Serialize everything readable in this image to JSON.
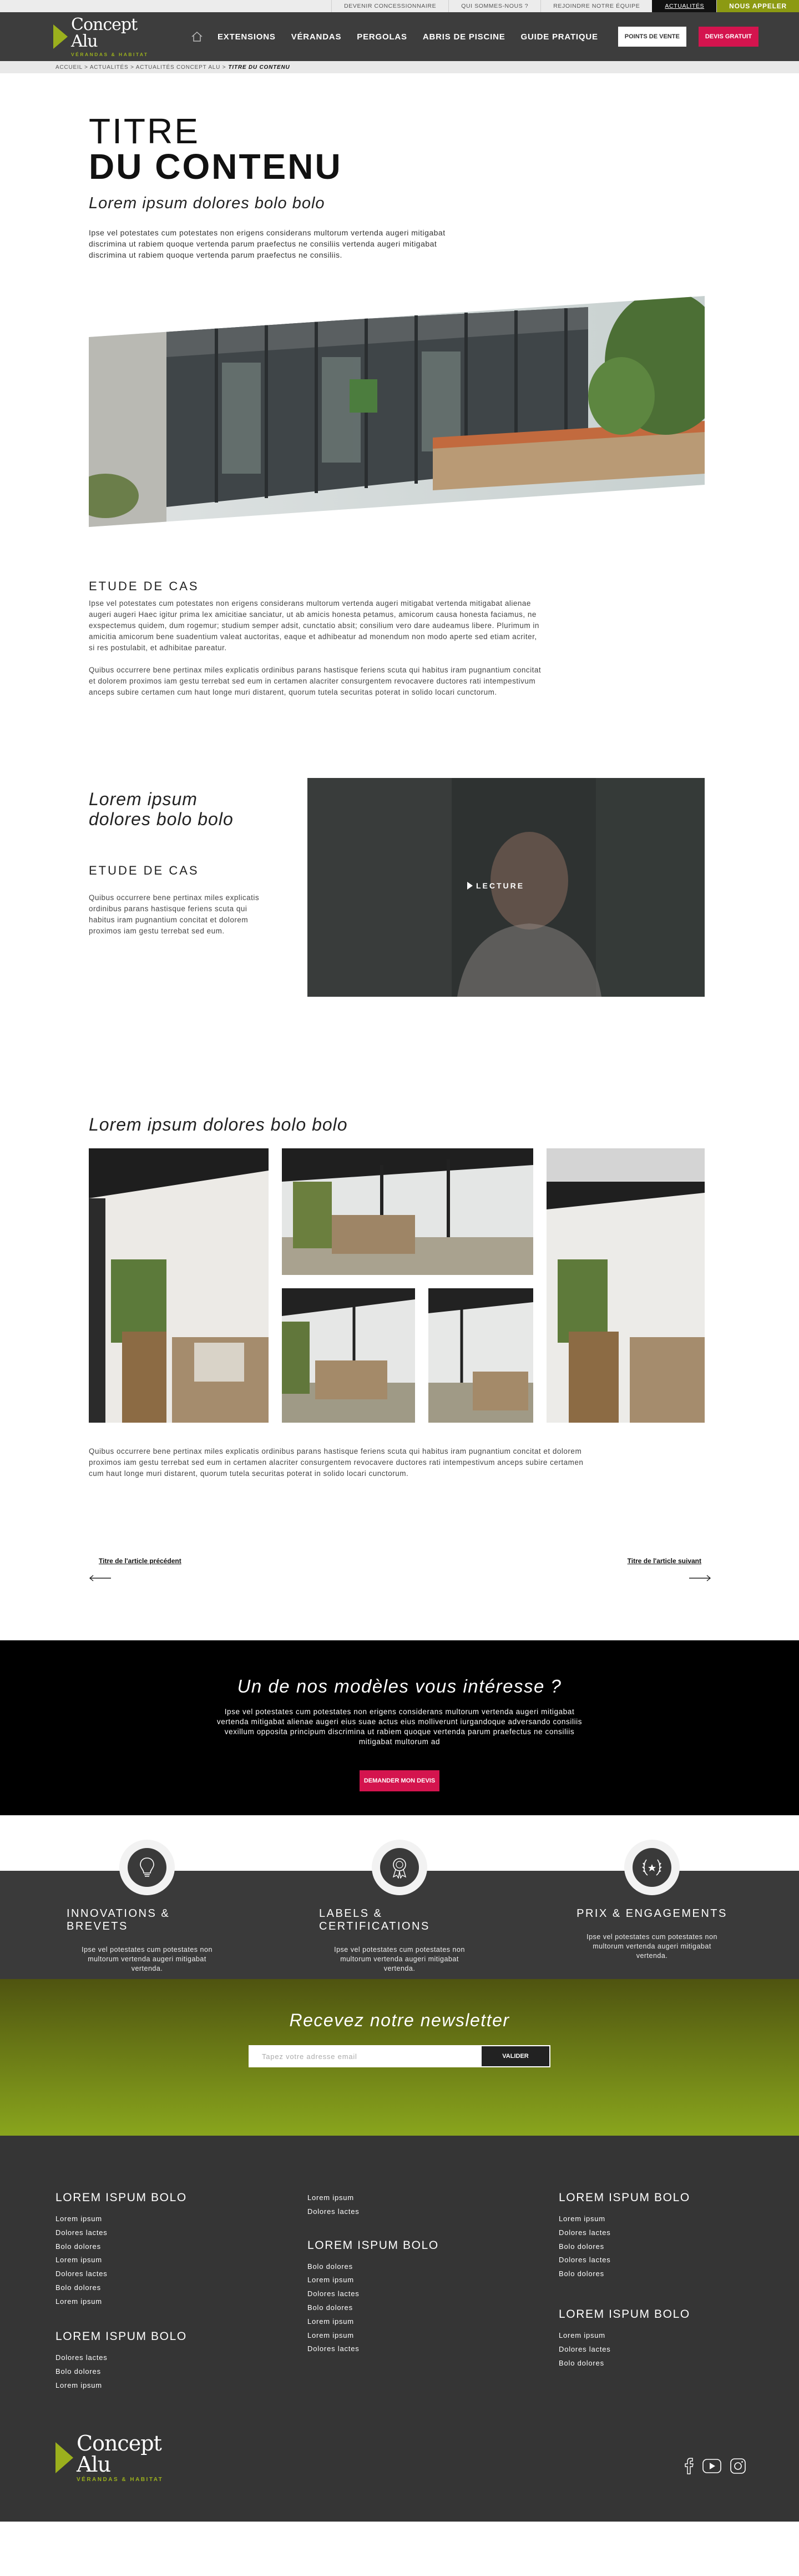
{
  "topbar": {
    "items": [
      "DEVENIR CONCESSIONNAIRE",
      "QUI SOMMES-NOUS ?",
      "REJOINDRE NOTRE ÉQUIPE",
      "ACTUALITÉS"
    ],
    "call": "NOUS APPELER"
  },
  "header": {
    "logo_name": "Concept Alu",
    "logo_sub": "VÉRANDAS & HABITAT",
    "nav": [
      "EXTENSIONS",
      "VÉRANDAS",
      "PERGOLAS",
      "ABRIS DE PISCINE",
      "GUIDE PRATIQUE"
    ],
    "btn_pdv": "POINTS DE VENTE",
    "btn_devis": "DEVIS GRATUIT"
  },
  "breadcrumb": {
    "path": "ACCUEIL > ACTUALITÉS > ACTUALITÉS CONCEPT ALU >",
    "current": "TITRE DU CONTENU"
  },
  "article": {
    "title_light": "TITRE",
    "title_bold": "DU CONTENU",
    "subtitle": "Lorem ipsum dolores bolo bolo",
    "intro": "Ipse vel potestates cum potestates non erigens considerans multorum vertenda augeri mitigabat discrimina ut rabiem quoque vertenda parum praefectus ne consiliis vertenda augeri mitigabat discrimina ut rabiem quoque vertenda parum praefectus ne consiliis.",
    "etude_title": "ETUDE DE CAS",
    "etude_p1": "Ipse vel potestates cum potestates non erigens considerans multorum vertenda augeri mitigabat vertenda mitigabat alienae augeri augeri Haec igitur prima lex amicitiae sanciatur, ut ab amicis honesta petamus, amicorum causa honesta faciamus, ne exspectemus quidem, dum rogemur; studium semper adsit, cunctatio absit; consilium vero dare audeamus libere. Plurimum in amicitia amicorum bene suadentium valeat auctoritas, eaque et adhibeatur ad monendum non modo aperte sed etiam acriter, si res postulabit, et adhibitae pareatur.",
    "etude_p2": "Quibus occurrere bene pertinax miles explicatis ordinibus parans hastisque feriens scuta qui habitus iram pugnantium concitat et dolorem proximos iam gestu terrebat sed eum in certamen alacriter consurgentem revocavere ductores rati intempestivum anceps subire certamen cum haut longe muri distarent, quorum tutela securitas poterat in solido locari cunctorum.",
    "video_title": "Lorem ipsum dolores bolo bolo",
    "video_etude": "ETUDE DE CAS",
    "video_p": "Quibus occurrere bene pertinax miles explicatis ordinibus parans hastisque feriens scuta qui habitus iram pugnantium concitat et dolorem proximos iam gestu terrebat sed eum.",
    "video_label": "LECTURE",
    "gallery_title": "Lorem ipsum dolores bolo bolo",
    "gallery_p": "Quibus occurrere bene pertinax miles explicatis ordinibus parans hastisque feriens scuta qui habitus iram pugnantium concitat et dolorem proximos iam gestu terrebat sed eum in certamen alacriter consurgentem revocavere ductores rati intempestivum anceps subire certamen cum haut longe muri distarent, quorum tutela securitas poterat in solido locari cunctorum.",
    "prev": "Titre de l'article précédent",
    "next": "Titre de l'article suivant"
  },
  "cta": {
    "title": "Un de nos modèles vous intéresse ?",
    "text": "Ipse vel potestates cum potestates non erigens considerans multorum vertenda augeri mitigabat vertenda mitigabat alienae augeri eius suae actus eius molliverunt iurgandoque adversando consiliis vexillum opposita principum discrimina ut rabiem quoque vertenda parum praefectus ne consiliis mitigabat multorum ad",
    "button": "DEMANDER MON DEVIS"
  },
  "features": [
    {
      "icon": "lightbulb-icon",
      "title": "INNOVATIONS & BREVETS",
      "text": "Ipse vel potestates cum potestates non multorum vertenda augeri mitigabat vertenda."
    },
    {
      "icon": "badge-icon",
      "title": "LABELS & CERTIFICATIONS",
      "text": "Ipse vel potestates cum potestates non multorum vertenda augeri mitigabat vertenda."
    },
    {
      "icon": "laurel-icon",
      "title": "PRIX & ENGAGEMENTS",
      "text": "Ipse vel potestates cum potestates non multorum vertenda augeri mitigabat vertenda."
    }
  ],
  "newsletter": {
    "title": "Recevez notre newsletter",
    "placeholder": "Tapez votre adresse email",
    "button": "VALIDER"
  },
  "footer": {
    "col1_title": "LOREM ISPUM BOLO",
    "col1": [
      "Lorem ipsum",
      "Dolores lactes",
      "Bolo dolores",
      "Lorem ipsum",
      "Dolores lactes",
      "Bolo dolores",
      "Lorem ipsum"
    ],
    "col1b_title": "LOREM ISPUM BOLO",
    "col1b": [
      "Dolores lactes",
      "Bolo dolores",
      "Lorem ipsum"
    ],
    "col2a": [
      "Lorem ipsum",
      "Dolores lactes"
    ],
    "col2_title": "LOREM ISPUM BOLO",
    "col2": [
      "Bolo dolores",
      "Lorem ipsum",
      "Dolores lactes",
      "Bolo dolores",
      "Lorem ipsum",
      "Lorem ipsum",
      "Dolores lactes"
    ],
    "col3_title": "LOREM ISPUM BOLO",
    "col3": [
      "Lorem ipsum",
      "Dolores lactes",
      "Bolo dolores",
      "Dolores lactes",
      "Bolo dolores"
    ],
    "col3b_title": "LOREM ISPUM BOLO",
    "col3b": [
      "Lorem ipsum",
      "Dolores lactes",
      "Bolo dolores"
    ],
    "logo_name": "Concept Alu",
    "logo_sub": "VÉRANDAS & HABITAT"
  },
  "colors": {
    "accent_green": "#8c9a12",
    "accent_pink": "#d4144e",
    "dark": "#3d3d3d"
  }
}
